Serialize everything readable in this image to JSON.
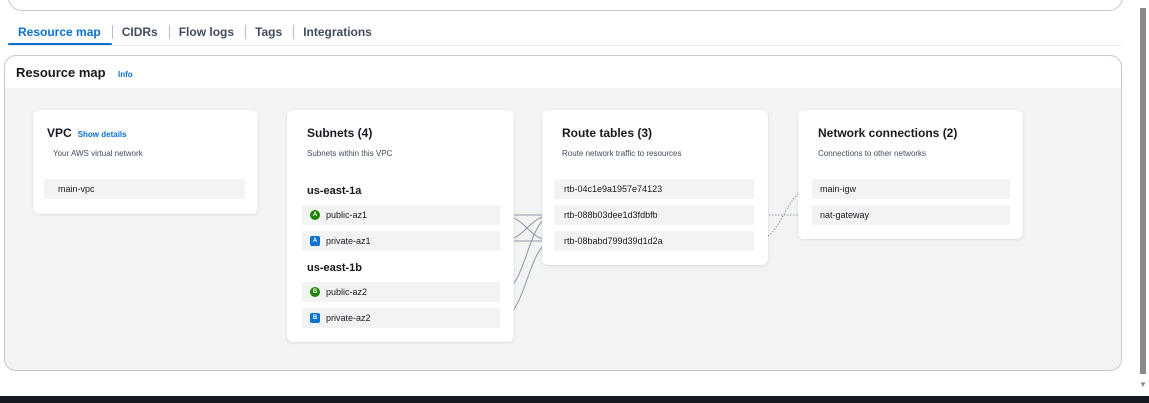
{
  "tabs": [
    {
      "label": "Resource map",
      "active": true
    },
    {
      "label": "CIDRs"
    },
    {
      "label": "Flow logs"
    },
    {
      "label": "Tags"
    },
    {
      "label": "Integrations"
    }
  ],
  "panel": {
    "title": "Resource map",
    "info": "Info"
  },
  "vpc": {
    "title": "VPC",
    "show_details": "Show details",
    "subtitle": "Your AWS virtual network",
    "items": [
      "main-vpc"
    ]
  },
  "subnets": {
    "title": "Subnets (4)",
    "subtitle": "Subnets within this VPC",
    "regions": [
      {
        "name": "us-east-1a",
        "items": [
          {
            "label": "public-az1",
            "badge": "A",
            "kind": "public"
          },
          {
            "label": "private-az1",
            "badge": "A",
            "kind": "private"
          }
        ]
      },
      {
        "name": "us-east-1b",
        "items": [
          {
            "label": "public-az2",
            "badge": "B",
            "kind": "public"
          },
          {
            "label": "private-az2",
            "badge": "B",
            "kind": "private"
          }
        ]
      }
    ]
  },
  "route_tables": {
    "title": "Route tables (3)",
    "subtitle": "Route network traffic to resources",
    "items": [
      "rtb-04c1e9a1957e74123",
      "rtb-088b03dee1d3fdbfb",
      "rtb-08babd799d39d1d2a"
    ]
  },
  "network": {
    "title": "Network connections (2)",
    "subtitle": "Connections to other networks",
    "items": [
      "main-igw",
      "nat-gateway"
    ]
  },
  "colors": {
    "accent": "#0972d3",
    "public_badge": "#1d8102",
    "private_badge": "#0972d3",
    "connector": "#8d99a8"
  }
}
